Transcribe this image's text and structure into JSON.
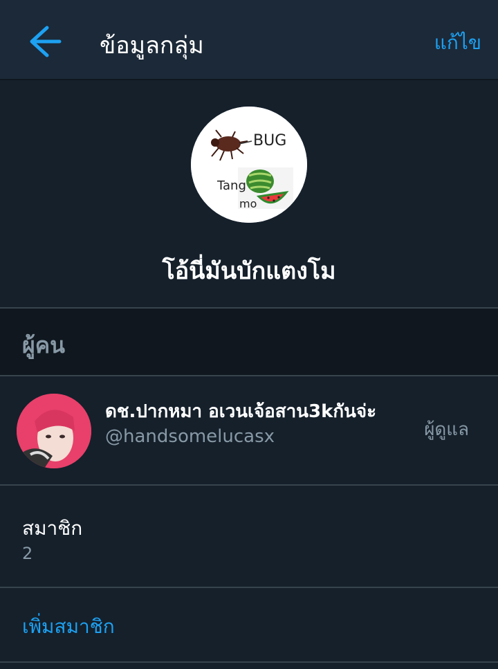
{
  "header": {
    "back_icon": "arrow-left-icon",
    "title": "ข้อมูลกลุ่ม",
    "edit_label": "แก้ไข"
  },
  "group": {
    "avatar_text_bug": "BUG",
    "avatar_text_tang": "Tang",
    "avatar_text_mo": "mo",
    "name": "โอ้นี่มันบักแตงโม"
  },
  "people": {
    "section_label": "ผู้คน",
    "members": [
      {
        "display_name": "ดช.ปากหมา อเวนเจ้อสาน3kกันจ่ะ",
        "handle": "@handsomelucasx",
        "role": "ผู้ดูแล"
      }
    ]
  },
  "members_info": {
    "label": "สมาชิก",
    "count": "2"
  },
  "add_member": {
    "label": "เพิ่มสมาชิก"
  },
  "colors": {
    "background": "#15202b",
    "header_bg": "#1c2938",
    "accent": "#1da1f2",
    "muted_text": "#8899a6",
    "divider": "#38444d"
  }
}
